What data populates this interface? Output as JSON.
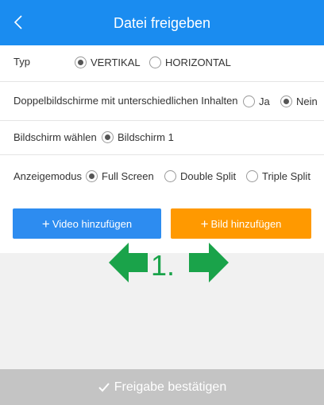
{
  "header": {
    "title": "Datei freigeben",
    "back_icon": "chevron-left-icon"
  },
  "type_row": {
    "label": "Typ",
    "options": [
      {
        "label": "VERTIKAL",
        "checked": true
      },
      {
        "label": "HORIZONTAL",
        "checked": false
      }
    ]
  },
  "dual_screen_row": {
    "label": "Doppelbildschirme mit unterschiedlichen Inhalten",
    "options": [
      {
        "label": "Ja",
        "checked": false
      },
      {
        "label": "Nein",
        "checked": true
      }
    ]
  },
  "screen_row": {
    "label": "Bildschirm wählen",
    "options": [
      {
        "label": "Bildschirm 1",
        "checked": true
      }
    ]
  },
  "display_mode_row": {
    "label": "Anzeigemodus",
    "options": [
      {
        "label": "Full Screen",
        "checked": true
      },
      {
        "label": "Double Split",
        "checked": false
      },
      {
        "label": "Triple Split",
        "checked": false
      }
    ]
  },
  "buttons": {
    "add_video": {
      "label": "Video hinzufügen",
      "icon": "plus-icon",
      "color": "#2d8cf0"
    },
    "add_image": {
      "label": "Bild hinzufügen",
      "icon": "plus-icon",
      "color": "#ff9900"
    }
  },
  "annotation": {
    "text": "1.",
    "color": "#1aa34a"
  },
  "footer": {
    "confirm_label": "Freigabe bestätigen",
    "icon": "checkmark-icon",
    "color": "#c4c4c4"
  }
}
